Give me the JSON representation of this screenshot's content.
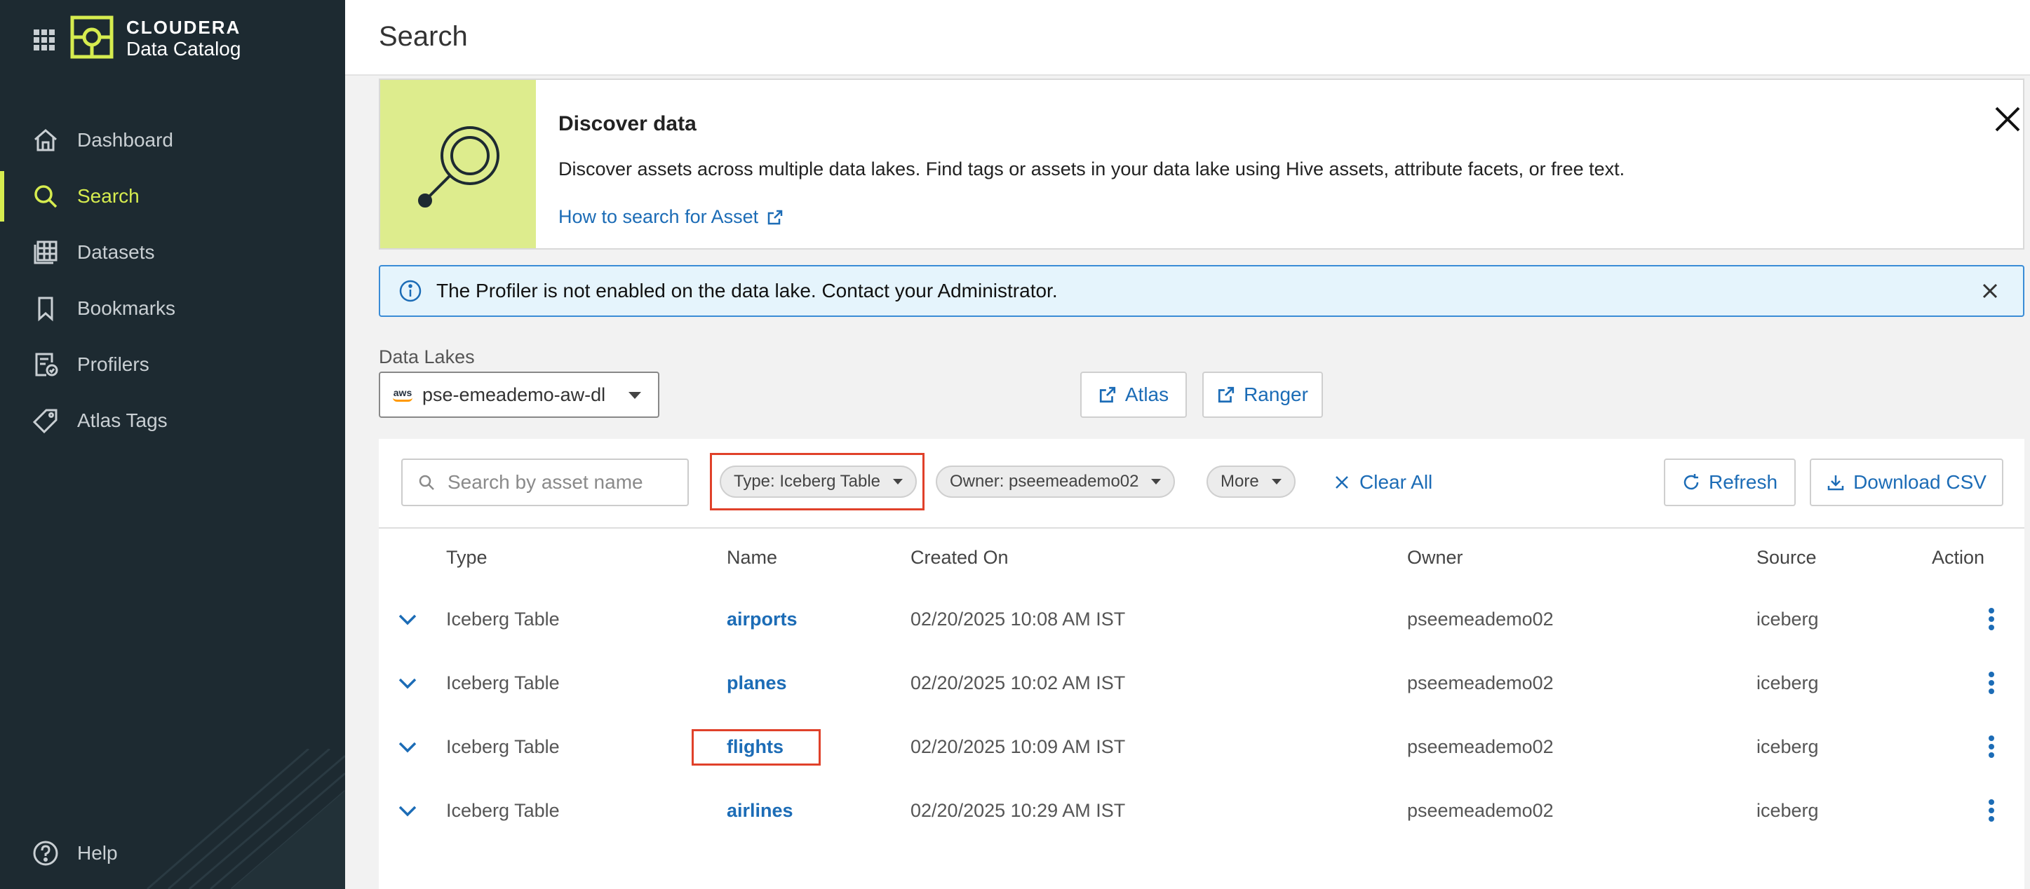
{
  "brand": {
    "line1": "CLOUDERA",
    "line2": "Data Catalog"
  },
  "sidebar": {
    "items": [
      {
        "label": "Dashboard",
        "icon": "home-icon",
        "active": false
      },
      {
        "label": "Search",
        "icon": "search-icon",
        "active": true
      },
      {
        "label": "Datasets",
        "icon": "datasets-icon",
        "active": false
      },
      {
        "label": "Bookmarks",
        "icon": "bookmark-icon",
        "active": false
      },
      {
        "label": "Profilers",
        "icon": "profiler-icon",
        "active": false
      },
      {
        "label": "Atlas Tags",
        "icon": "tag-icon",
        "active": false
      }
    ],
    "help": "Help"
  },
  "header": {
    "title": "Search"
  },
  "discover": {
    "title": "Discover data",
    "text": "Discover assets across multiple data lakes. Find tags or assets in your data lake using Hive assets, attribute facets, or free text.",
    "link": "How to search for Asset"
  },
  "alert": {
    "message": "The Profiler is not enabled on the data lake. Contact your Administrator."
  },
  "datalake": {
    "label": "Data Lakes",
    "selected": "pse-emeademo-aw-dl",
    "provider": "aws"
  },
  "links": {
    "atlas": "Atlas",
    "ranger": "Ranger"
  },
  "filters": {
    "search_placeholder": "Search by asset name",
    "type_chip": "Type: Iceberg Table",
    "owner_chip": "Owner: pseemeademo02",
    "more_chip": "More",
    "clear_all": "Clear All",
    "refresh": "Refresh",
    "download_csv": "Download CSV"
  },
  "table": {
    "columns": [
      "Type",
      "Name",
      "Created On",
      "Owner",
      "Source",
      "Action"
    ],
    "rows": [
      {
        "type": "Iceberg Table",
        "name": "airports",
        "created": "02/20/2025 10:08 AM IST",
        "owner": "pseemeademo02",
        "source": "iceberg"
      },
      {
        "type": "Iceberg Table",
        "name": "planes",
        "created": "02/20/2025 10:02 AM IST",
        "owner": "pseemeademo02",
        "source": "iceberg"
      },
      {
        "type": "Iceberg Table",
        "name": "flights",
        "created": "02/20/2025 10:09 AM IST",
        "owner": "pseemeademo02",
        "source": "iceberg"
      },
      {
        "type": "Iceberg Table",
        "name": "airlines",
        "created": "02/20/2025 10:29 AM IST",
        "owner": "pseemeademo02",
        "source": "iceberg"
      }
    ]
  },
  "colors": {
    "sidebar_bg": "#1d2a31",
    "accent": "#d6ec4f",
    "link": "#1c6cb6",
    "highlight": "#e0412a"
  }
}
